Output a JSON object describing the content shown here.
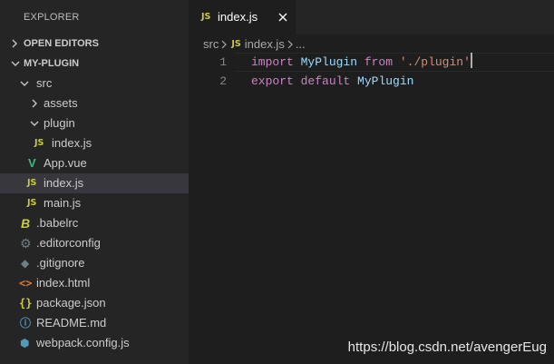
{
  "explorer": {
    "title": "EXPLORER",
    "open_editors_label": "OPEN EDITORS",
    "project_label": "MY-PLUGIN",
    "tree": [
      {
        "label": "src",
        "icon": "chevron-down-icon"
      },
      {
        "label": "assets",
        "icon": "chevron-right-icon"
      },
      {
        "label": "plugin",
        "icon": "chevron-down-icon"
      },
      {
        "label": "index.js",
        "icon": "js-file-icon",
        "icon_text": "JS"
      },
      {
        "label": "App.vue",
        "icon": "vue-file-icon",
        "icon_text": "V"
      },
      {
        "label": "index.js",
        "icon": "js-file-icon",
        "icon_text": "JS",
        "selected": true
      },
      {
        "label": "main.js",
        "icon": "js-file-icon",
        "icon_text": "JS"
      },
      {
        "label": ".babelrc",
        "icon": "babel-file-icon",
        "icon_text": "B"
      },
      {
        "label": ".editorconfig",
        "icon": "gear-icon",
        "icon_text": "⚙"
      },
      {
        "label": ".gitignore",
        "icon": "git-icon",
        "icon_text": "◆"
      },
      {
        "label": "index.html",
        "icon": "html-file-icon",
        "icon_text": "<>"
      },
      {
        "label": "package.json",
        "icon": "json-file-icon",
        "icon_text": "{}"
      },
      {
        "label": "README.md",
        "icon": "info-icon",
        "icon_text": "ⓘ"
      },
      {
        "label": "webpack.config.js",
        "icon": "webpack-icon",
        "icon_text": "⬢"
      }
    ]
  },
  "editor": {
    "tab": {
      "icon_text": "JS",
      "label": "index.js"
    },
    "breadcrumb": {
      "folder": "src",
      "icon_text": "JS",
      "file": "index.js",
      "more": "..."
    },
    "lines": [
      {
        "number": "1",
        "t1": "import",
        "t2": " MyPlugin ",
        "t3": "from",
        "t4": " ",
        "t5": "'./plugin'"
      },
      {
        "number": "2",
        "t1": "export",
        "t2": " ",
        "t3": "default",
        "t4": " ",
        "t5": "MyPlugin"
      }
    ]
  },
  "watermark": "https://blog.csdn.net/avengerEug",
  "colors": {
    "sidebar_bg": "#252526",
    "editor_bg": "#1e1e1e",
    "selected_row": "#37373d",
    "keyword": "#c586c0",
    "identifier": "#9cdcfe",
    "string": "#ce9178",
    "js_icon": "#cbcb41"
  }
}
